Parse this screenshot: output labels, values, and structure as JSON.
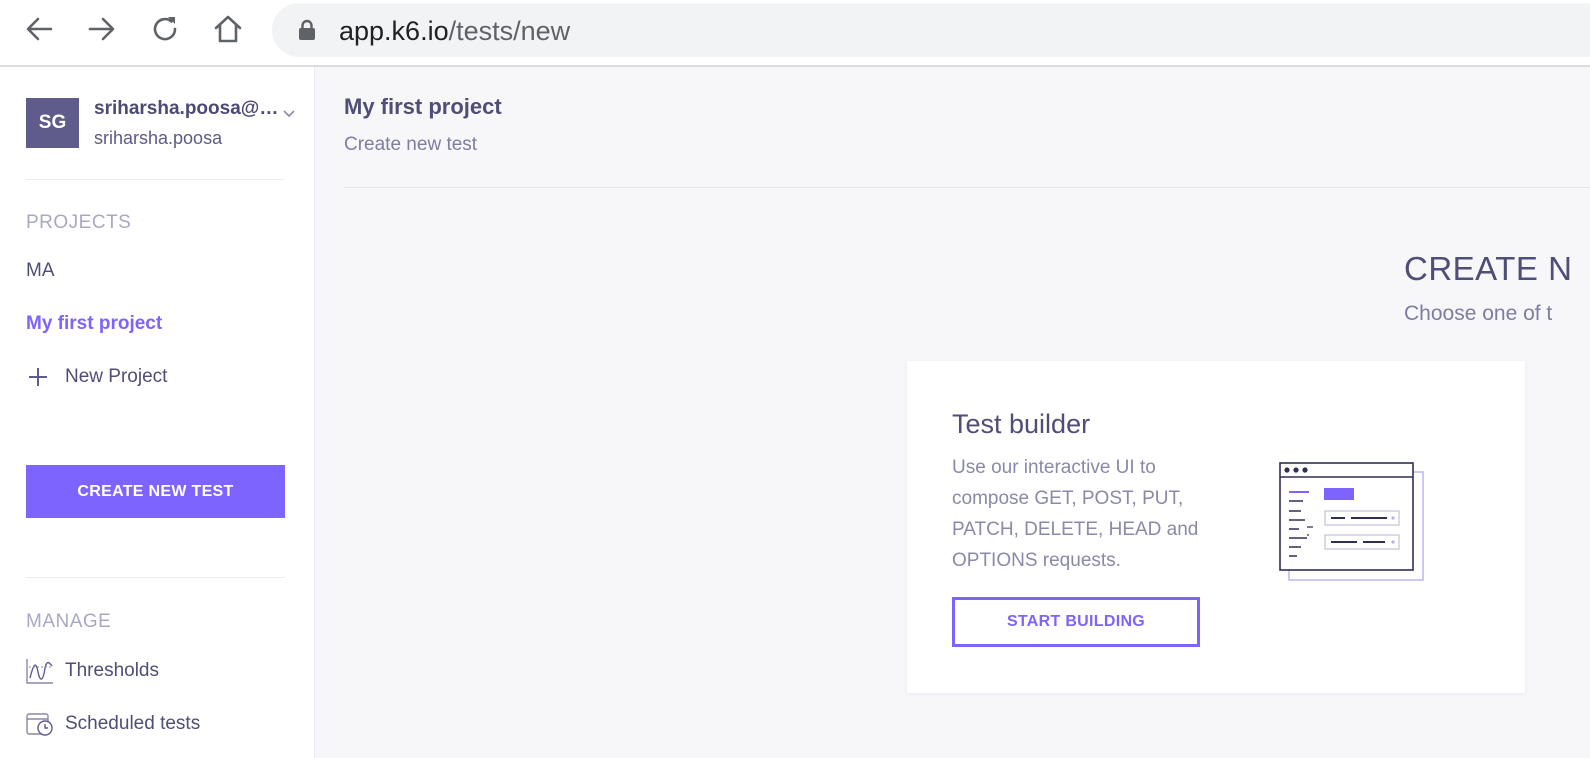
{
  "browser": {
    "url_host": "app.k6.io",
    "url_path": "/tests/new",
    "icons": [
      "back-arrow-icon",
      "forward-arrow-icon",
      "reload-icon",
      "home-icon",
      "lock-icon"
    ]
  },
  "sidebar": {
    "user": {
      "initials": "SG",
      "email": "sriharsha.poosa@g...",
      "username": "sriharsha.poosa"
    },
    "projects_label": "PROJECTS",
    "projects": [
      {
        "label": "MA",
        "active": false
      },
      {
        "label": "My first project",
        "active": true
      }
    ],
    "new_project_label": "New Project",
    "create_test_label": "CREATE NEW TEST",
    "manage_label": "MANAGE",
    "manage_items": [
      {
        "label": "Thresholds",
        "icon": "thresholds-icon"
      },
      {
        "label": "Scheduled tests",
        "icon": "scheduled-tests-icon"
      }
    ]
  },
  "main": {
    "project_title": "My first project",
    "page_subtitle": "Create new test",
    "heading": "CREATE N",
    "subheading": "Choose one of t",
    "card": {
      "title": "Test builder",
      "description": "Use our interactive UI to compose GET, POST, PUT, PATCH, DELETE, HEAD and OPTIONS requests.",
      "button_label": "START BUILDING",
      "icon": "test-builder-illustration"
    }
  },
  "colors": {
    "accent": "#7d64ff",
    "text_dark": "#4f4e76",
    "avatar_bg": "#5f5c8c",
    "page_bg": "#f7f7fa"
  }
}
